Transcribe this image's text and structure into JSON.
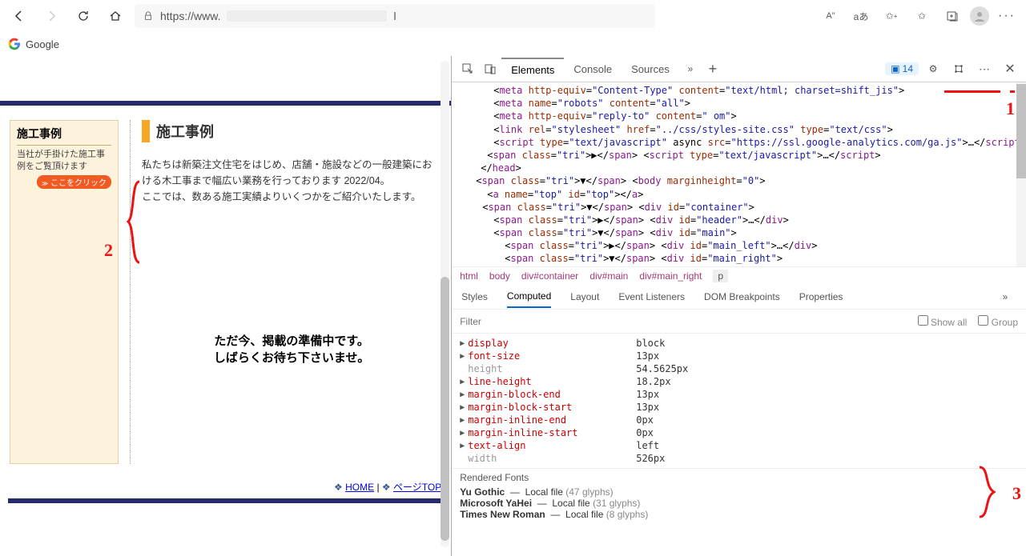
{
  "browser": {
    "url_prefix": "https://www.",
    "url_suffix": "l",
    "lang_badge": "aあ",
    "ai_badge": "A\""
  },
  "bookmarks": {
    "google": "Google"
  },
  "page": {
    "sidebar": {
      "title": "施工事例",
      "desc": "当社が手掛けた施工事例をご覧頂けます",
      "button": "ここをクリック"
    },
    "section_title": "施工事例",
    "intro1": "私たちは新築注文住宅をはじめ、店舗・施設などの一般建築における木工事まで幅広い業務を行っております 2022/04。",
    "intro2": "ここでは、数ある施工実績よりいくつかをご紹介いたします。",
    "preparing1": "ただ今、掲載の準備中です。",
    "preparing2": "しばらくお待ち下さいませ。",
    "diamond": "❖",
    "home": "HOME",
    "sep": " | ",
    "pagetop": "ページTOP"
  },
  "annotations": {
    "n1": "1",
    "n2": "2",
    "n3": "3"
  },
  "devtools": {
    "tabs": {
      "elements": "Elements",
      "console": "Console",
      "sources": "Sources"
    },
    "issues_count": "14",
    "elements_lines": [
      "<meta http-equiv=\"Content-Type\" content=\"text/html; charset=shift_jis\">",
      "<meta name=\"robots\" content=\"all\">",
      "<meta http-equiv=\"reply-to\" content=\"                        om\">",
      "<link rel=\"stylesheet\" href=\"../css/styles-site.css\" type=\"text/css\">",
      "<script type=\"text/javascript\" async src=\"https://ssl.google-analytics.com/ga.js\">…</script>",
      "▶ <script type=\"text/javascript\">…</script>",
      "</head>",
      "▼ <body marginheight=\"0\">",
      "  <a name=\"top\" id=\"top\"></a>",
      "▼ <div id=\"container\">",
      "  ▶ <div id=\"header\">…</div>",
      "  ▼ <div id=\"main\">",
      "    ▶ <div id=\"main_left\">…</div>",
      "    ▼ <div id=\"main_right\">"
    ],
    "breadcrumbs": [
      "html",
      "body",
      "div#container",
      "div#main",
      "div#main_right",
      "p"
    ],
    "subtabs": [
      "Styles",
      "Computed",
      "Layout",
      "Event Listeners",
      "DOM Breakpoints",
      "Properties"
    ],
    "filter_placeholder": "Filter",
    "show_all": "Show all",
    "group": "Group",
    "computed": [
      {
        "name": "display",
        "val": "block",
        "gray": false,
        "tri": true
      },
      {
        "name": "font-size",
        "val": "13px",
        "gray": false,
        "tri": true
      },
      {
        "name": "height",
        "val": "54.5625px",
        "gray": true,
        "tri": false
      },
      {
        "name": "line-height",
        "val": "18.2px",
        "gray": false,
        "tri": true
      },
      {
        "name": "margin-block-end",
        "val": "13px",
        "gray": false,
        "tri": true
      },
      {
        "name": "margin-block-start",
        "val": "13px",
        "gray": false,
        "tri": true
      },
      {
        "name": "margin-inline-end",
        "val": "0px",
        "gray": false,
        "tri": true
      },
      {
        "name": "margin-inline-start",
        "val": "0px",
        "gray": false,
        "tri": true
      },
      {
        "name": "text-align",
        "val": "left",
        "gray": false,
        "tri": true
      },
      {
        "name": "width",
        "val": "526px",
        "gray": true,
        "tri": false
      }
    ],
    "fonts_head": "Rendered Fonts",
    "fonts": [
      {
        "name": "Yu Gothic",
        "src": "Local file",
        "glyphs": "(47 glyphs)"
      },
      {
        "name": "Microsoft YaHei",
        "src": "Local file",
        "glyphs": "(31 glyphs)"
      },
      {
        "name": "Times New Roman",
        "src": "Local file",
        "glyphs": "(8 glyphs)"
      }
    ]
  }
}
